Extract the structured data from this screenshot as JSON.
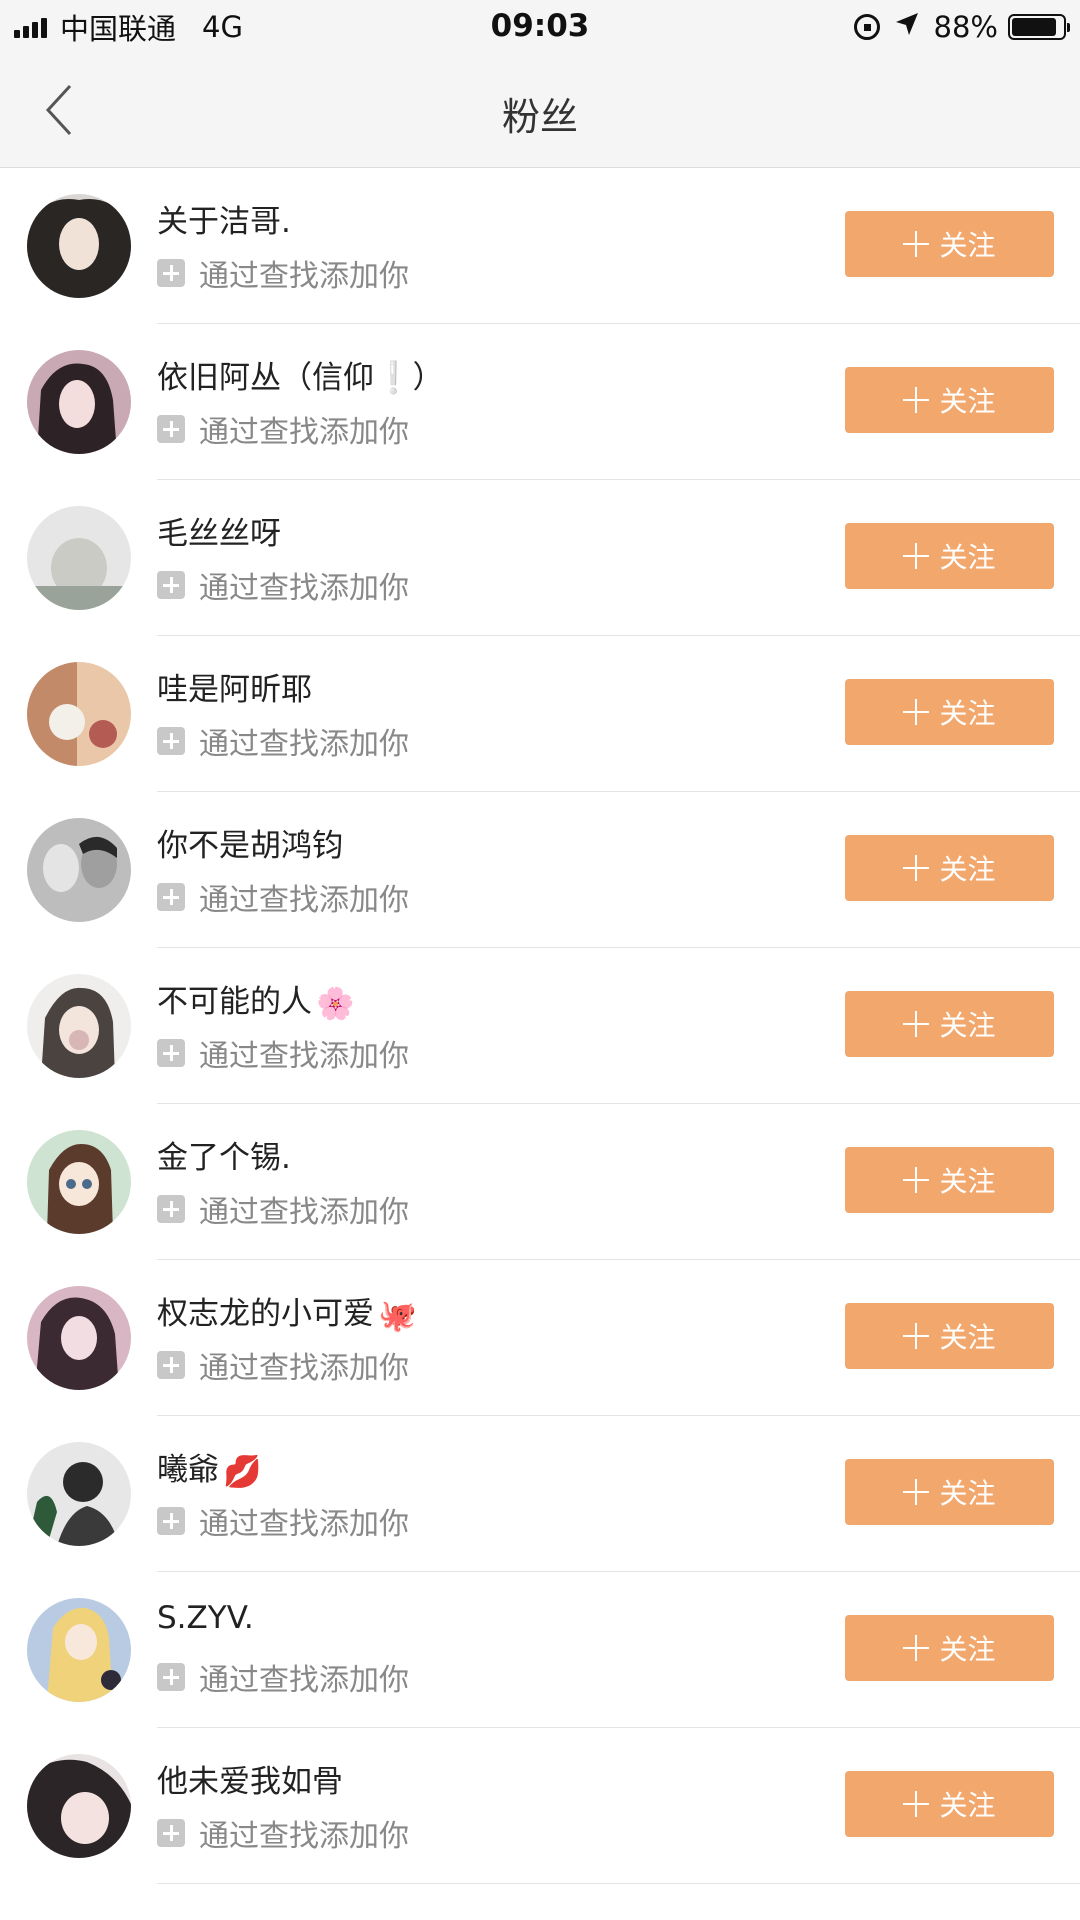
{
  "status_bar": {
    "carrier": "中国联通",
    "network": "4G",
    "time": "09:03",
    "battery": "88%",
    "battery_level": 0.88,
    "icons": [
      "signal-icon",
      "rotation-lock-icon",
      "location-arrow-icon",
      "battery-icon"
    ]
  },
  "nav": {
    "title": "粉丝",
    "back_icon": "chevron-left-icon"
  },
  "colors": {
    "accent": "#f2a76d",
    "background": "#ffffff",
    "nav_background": "#f5f5f5",
    "secondary_text": "#888888"
  },
  "followers": [
    {
      "name": "关于洁哥.",
      "emoji": "",
      "source": "通过查找添加你",
      "button": "关注"
    },
    {
      "name": "依旧阿丛（信仰❕）",
      "emoji": "",
      "source": "通过查找添加你",
      "button": "关注"
    },
    {
      "name": "毛丝丝呀",
      "emoji": "",
      "source": "通过查找添加你",
      "button": "关注"
    },
    {
      "name": "哇是阿昕耶",
      "emoji": "",
      "source": "通过查找添加你",
      "button": "关注"
    },
    {
      "name": "你不是胡鸿钧",
      "emoji": "",
      "source": "通过查找添加你",
      "button": "关注"
    },
    {
      "name": "不可能的人",
      "emoji": "🌸",
      "source": "通过查找添加你",
      "button": "关注"
    },
    {
      "name": "金了个锡.",
      "emoji": "",
      "source": "通过查找添加你",
      "button": "关注"
    },
    {
      "name": "权志龙的小可爱",
      "emoji": "🐙",
      "source": "通过查找添加你",
      "button": "关注"
    },
    {
      "name": "曦爺",
      "emoji": "💋",
      "source": "通过查找添加你",
      "button": "关注"
    },
    {
      "name": "S.ZYV.",
      "emoji": "",
      "source": "通过查找添加你",
      "button": "关注"
    },
    {
      "name": "他未爱我如骨",
      "emoji": "",
      "source": "通过查找添加你",
      "button": "关注"
    }
  ]
}
